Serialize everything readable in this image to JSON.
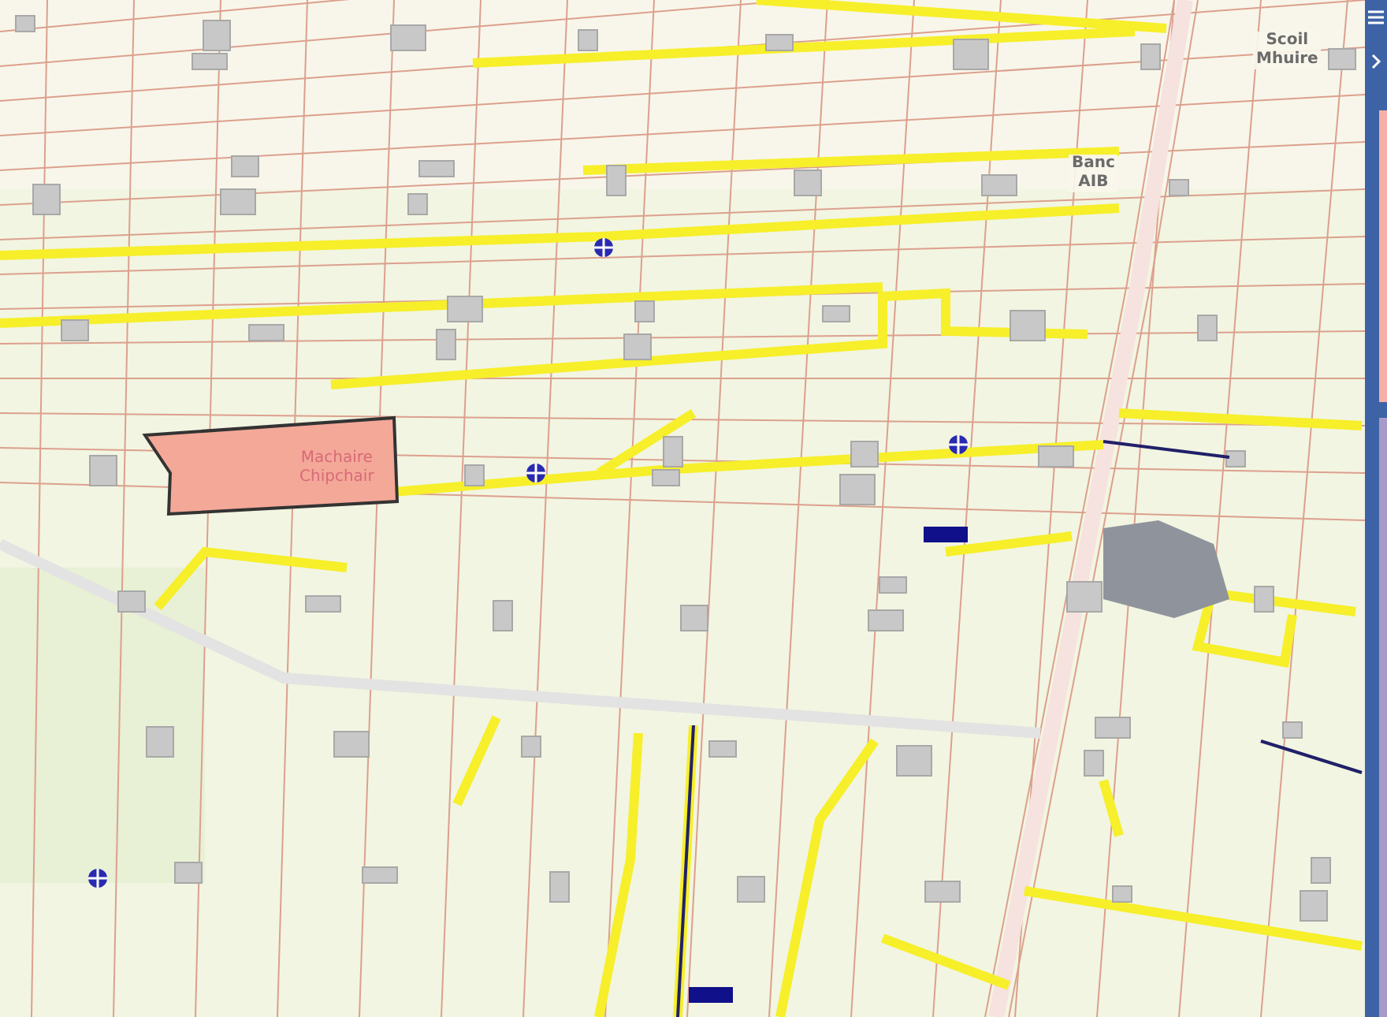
{
  "map": {
    "labels": [
      {
        "kind": "place",
        "lines": [
          "Scoil",
          "Mhuire"
        ]
      },
      {
        "kind": "place",
        "lines": [
          "Banc",
          "AIB"
        ]
      },
      {
        "kind": "parcel",
        "lines": [
          "Machaire",
          "Chipchair"
        ]
      }
    ]
  },
  "sidebar": {
    "collapsed": true
  }
}
